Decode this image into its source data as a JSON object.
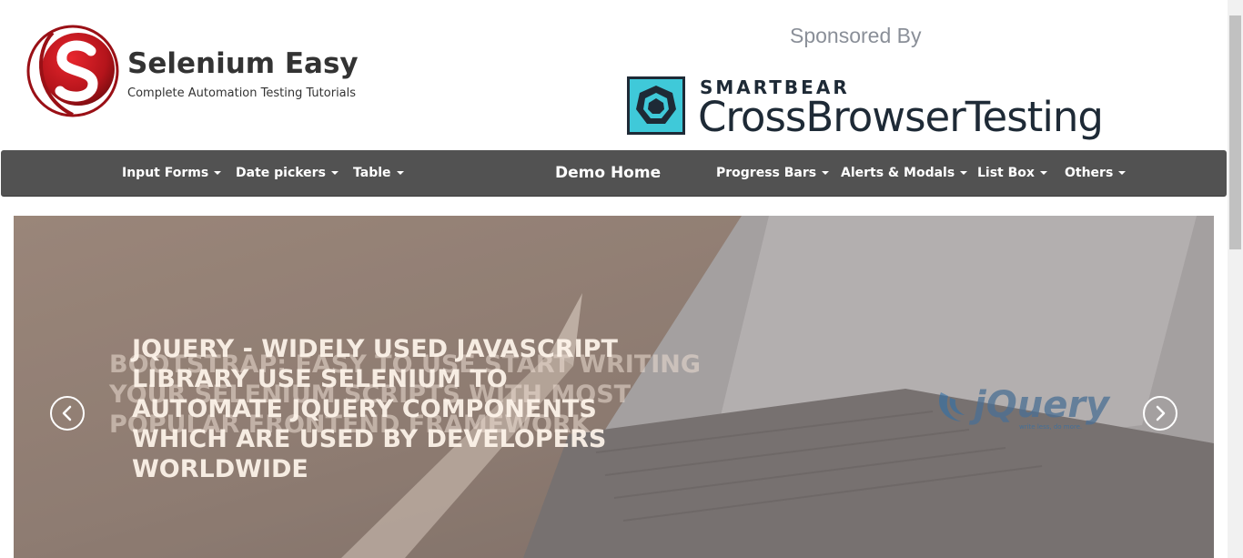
{
  "header": {
    "brand_title": "Selenium Easy",
    "brand_subtitle": "Complete Automation Testing Tutorials",
    "sponsor_label": "Sponsored By",
    "sponsor_brand_small": "SMARTBEAR",
    "sponsor_brand_big": "CrossBrowserTesting"
  },
  "nav": {
    "items": [
      {
        "label": "Input Forms",
        "dropdown": true
      },
      {
        "label": "Date pickers",
        "dropdown": true
      },
      {
        "label": "Table",
        "dropdown": true
      },
      {
        "label": "Demo Home",
        "dropdown": false
      },
      {
        "label": "Progress Bars",
        "dropdown": true
      },
      {
        "label": "Alerts & Modals",
        "dropdown": true
      },
      {
        "label": "List Box",
        "dropdown": true
      },
      {
        "label": "Others",
        "dropdown": true
      }
    ]
  },
  "carousel": {
    "slide_back_text": "Bootstrap: Easy to use Start writing your Selenium Scripts with most popular frontend framework",
    "slide_front_text": "jQuery - Widely used JavaScript Library Use Selenium to automate jQuery components which are used by developers worldwide",
    "slide_logo_name": "jQuery",
    "slide_logo_tagline": "write less, do more."
  },
  "icons": {
    "prev": "chevron-left-icon",
    "next": "chevron-right-icon"
  },
  "colors": {
    "navbar_bg": "#525252",
    "brand_red": "#c0161d",
    "smartbear_teal": "#3fc9d9",
    "smartbear_dark": "#1e2a36"
  }
}
